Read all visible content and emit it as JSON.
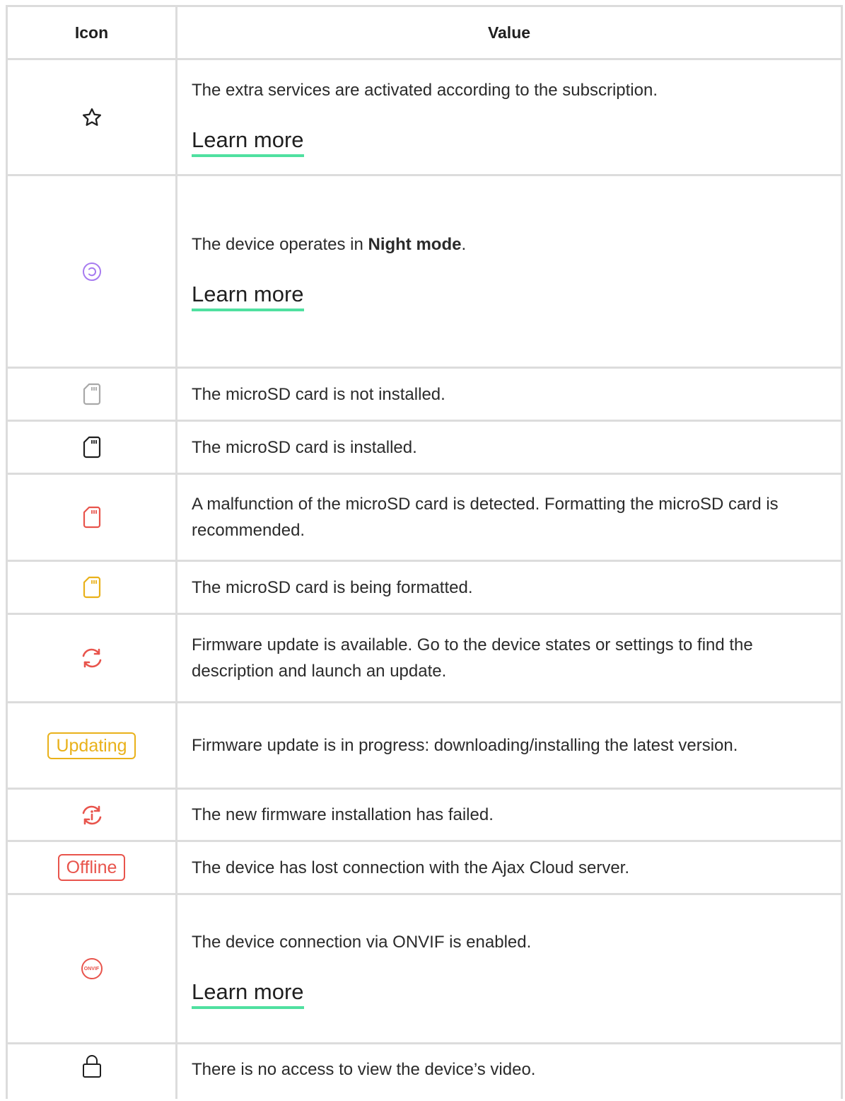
{
  "table": {
    "header": {
      "icon": "Icon",
      "value": "Value"
    },
    "rows": [
      {
        "icon": "star-icon",
        "text": "The extra services are activated according to the subscription.",
        "link": "Learn more"
      },
      {
        "icon": "night-mode-icon",
        "text_before": "The device operates in ",
        "text_bold": "Night mode",
        "text_after": ".",
        "link": "Learn more"
      },
      {
        "icon": "microsd-not-installed-icon",
        "text": "The microSD card is not installed."
      },
      {
        "icon": "microsd-installed-icon",
        "text": "The microSD card is installed."
      },
      {
        "icon": "microsd-malfunction-icon",
        "text": "A malfunction of the microSD card is detected. Formatting the microSD card is recommended."
      },
      {
        "icon": "microsd-formatting-icon",
        "text": "The microSD card is being formatted."
      },
      {
        "icon": "firmware-update-icon",
        "text": "Firmware update is available. Go to the device states or settings to find the description and launch an update."
      },
      {
        "badge": "Updating",
        "text": "Firmware update is in progress: downloading/installing the latest version."
      },
      {
        "icon": "firmware-failed-icon",
        "text": "The new firmware installation has failed."
      },
      {
        "badge": "Offline",
        "text": "The device has lost connection with the Ajax Cloud server."
      },
      {
        "icon": "onvif-icon",
        "icon_text": "ONVIF",
        "text": "The device connection via ONVIF is enabled.",
        "link": "Learn more"
      },
      {
        "icon": "lock-icon",
        "text": "There is no access to view the device’s video."
      }
    ]
  },
  "colors": {
    "link_underline": "#4fe0a0",
    "purple": "#a77bf0",
    "red": "#e8544c",
    "yellow": "#e9b11a",
    "gray": "#a8a8a8",
    "border": "#dcdcdc"
  }
}
